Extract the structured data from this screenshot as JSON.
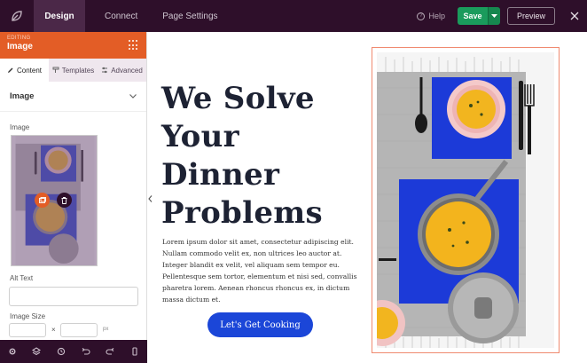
{
  "topbar": {
    "tabs": [
      {
        "label": "Design"
      },
      {
        "label": "Connect"
      },
      {
        "label": "Page Settings"
      }
    ],
    "help_label": "Help",
    "save_label": "Save",
    "preview_label": "Preview"
  },
  "sidebar": {
    "editing_label": "EDITING",
    "editing_title": "Image",
    "tabs": [
      {
        "label": "Content"
      },
      {
        "label": "Templates"
      },
      {
        "label": "Advanced"
      }
    ],
    "section_title": "Image",
    "image_label": "Image",
    "alt_text_label": "Alt Text",
    "alt_text_value": "",
    "image_size_label": "Image Size",
    "size_x_symbol": "×",
    "size_unit": "px"
  },
  "canvas": {
    "headline": "We Solve Your Dinner Problems",
    "body": "Lorem ipsum dolor sit amet, consectetur adipiscing elit. Nullam commodo velit ex, non ultrices leo auctor at. Integer blandit ex velit, vel aliquam sem tempor eu. Pellentesque sem tortor, elementum et nisi sed, convallis pharetra lorem. Aenean rhoncus rhoncus ex, in dictum massa dictum et.",
    "cta_label": "Let's Get Cooking"
  },
  "colors": {
    "topbar": "#2e0f2a",
    "accent": "#e35d26",
    "save": "#1a9b5c",
    "cta": "#1b46d8"
  }
}
